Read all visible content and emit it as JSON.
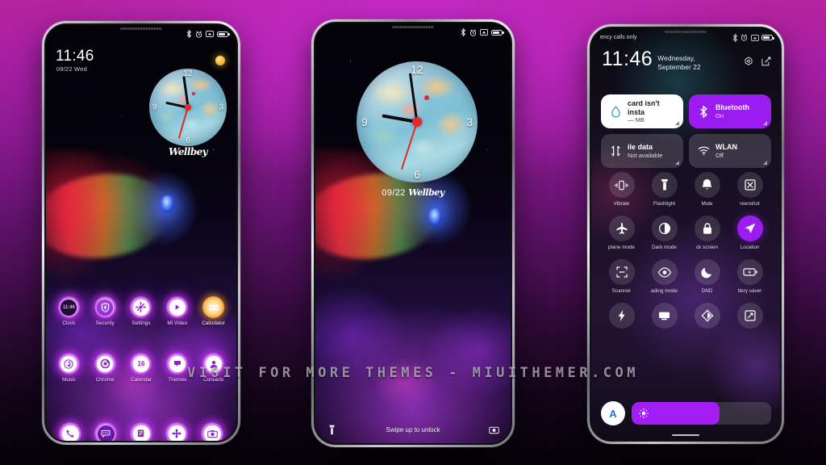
{
  "theme": {
    "accent_purple": "#9b1cf0",
    "background_top": "#b5249f",
    "background_bottom": "#050208",
    "icon_glow": "#cd3cf5",
    "calculator_orange": "#f0961c",
    "second_hand_red": "#e5262b"
  },
  "watermark": {
    "text": "VISIT FOR MORE THEMES - MIUITHEMER.COM"
  },
  "phone1": {
    "label": "home-screen",
    "statusbar": {
      "icons": [
        "bluetooth-icon",
        "alarm-icon",
        "screenshot-icon",
        "battery-icon"
      ]
    },
    "lockclock": {
      "time": "11:46",
      "date": "09/22 Wed"
    },
    "worldclock": {
      "numerals": [
        "12",
        "3",
        "6",
        "9"
      ],
      "brand": "Wellbey"
    },
    "apps_row1": [
      {
        "label": "Clock",
        "icon": "clock-icon",
        "mini_time": "11:46"
      },
      {
        "label": "Security",
        "icon": "shield-lock-icon"
      },
      {
        "label": "Settings",
        "icon": "gear-icon"
      },
      {
        "label": "Mi Video",
        "icon": "play-icon"
      },
      {
        "label": "Calculator",
        "icon": "equals-icon",
        "style": "orange"
      }
    ],
    "apps_row2": [
      {
        "label": "Music",
        "icon": "music-note-icon"
      },
      {
        "label": "Chrome",
        "icon": "chrome-icon"
      },
      {
        "label": "Calendar",
        "icon": "calendar-icon",
        "day": "16"
      },
      {
        "label": "Themes",
        "icon": "themes-icon"
      },
      {
        "label": "Contacts",
        "icon": "contacts-icon"
      }
    ],
    "dock": [
      {
        "label": "Phone",
        "icon": "phone-icon"
      },
      {
        "label": "Messages",
        "icon": "messages-icon"
      },
      {
        "label": "Notes",
        "icon": "notes-icon"
      },
      {
        "label": "Gallery",
        "icon": "gallery-flower-icon"
      },
      {
        "label": "Camera",
        "icon": "camera-icon"
      }
    ]
  },
  "phone2": {
    "label": "lock-screen",
    "statusbar": {
      "icons": [
        "bluetooth-icon",
        "alarm-icon",
        "screenshot-icon",
        "battery-icon"
      ]
    },
    "worldclock": {
      "numerals": [
        "12",
        "3",
        "6",
        "9"
      ]
    },
    "date_line": {
      "date": "09/22",
      "brand": "Wellbey"
    },
    "bottom": {
      "hint": "Swipe up to unlock",
      "left_icon": "flashlight-icon",
      "right_icon": "camera-icon"
    }
  },
  "phone3": {
    "label": "quick-settings-panel",
    "statusbar": {
      "carrier": "ency calls only",
      "icons": [
        "bluetooth-icon",
        "alarm-icon",
        "screenshot-icon",
        "battery-icon"
      ]
    },
    "header": {
      "time": "11:46",
      "date": "Wednesday, September 22",
      "icons": [
        "settings-gear-icon",
        "edit-icon"
      ]
    },
    "cards": [
      {
        "title": "card isn't insta",
        "subtitle": "— MB",
        "icon": "water-drop-icon",
        "style": "white"
      },
      {
        "title": "Bluetooth",
        "subtitle": "On",
        "icon": "bluetooth-icon",
        "style": "purple"
      },
      {
        "title": "ile data",
        "subtitle": "Not available",
        "icon": "mobile-data-icon",
        "style": "grey"
      },
      {
        "title": "WLAN",
        "subtitle": "Off",
        "icon": "wifi-icon",
        "style": "grey"
      }
    ],
    "tiles": [
      {
        "label": "Vibrate",
        "icon": "vibrate-icon",
        "on": false
      },
      {
        "label": "Flashlight",
        "icon": "flashlight-icon",
        "on": false
      },
      {
        "label": "Mute",
        "icon": "bell-icon",
        "on": false
      },
      {
        "label": "reenshot",
        "icon": "screenshot-icon",
        "on": false
      },
      {
        "label": "plane mode",
        "icon": "airplane-icon",
        "on": false
      },
      {
        "label": "Dark mode",
        "icon": "contrast-icon",
        "on": false
      },
      {
        "label": "ck screen",
        "icon": "lock-icon",
        "on": false
      },
      {
        "label": "Location",
        "icon": "location-arrow-icon",
        "on": true
      },
      {
        "label": "Scanner",
        "icon": "scanner-icon",
        "on": false
      },
      {
        "label": "ading mode",
        "icon": "eye-icon",
        "on": false
      },
      {
        "label": "DND",
        "icon": "moon-icon",
        "on": false
      },
      {
        "label": "ttery saver",
        "icon": "battery-saver-icon",
        "on": false
      },
      {
        "label": "",
        "icon": "flash-icon",
        "on": false
      },
      {
        "label": "",
        "icon": "cast-icon",
        "on": false
      },
      {
        "label": "",
        "icon": "sync-icon",
        "on": false
      },
      {
        "label": "",
        "icon": "rotate-icon",
        "on": false
      }
    ],
    "brightness": {
      "auto_label": "A",
      "level_percent": 63,
      "icon": "sun-icon"
    }
  }
}
